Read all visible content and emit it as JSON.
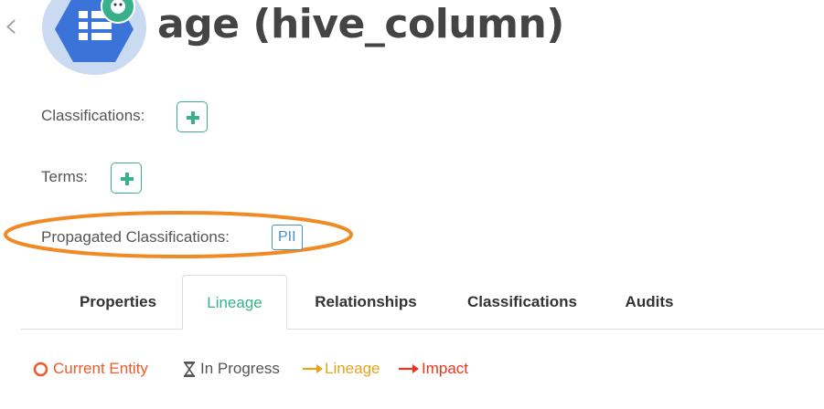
{
  "header": {
    "back_icon": "chevron-left-icon",
    "entity_icon": "table-column-icon",
    "title": "age (hive_column)"
  },
  "classifications": {
    "label": "Classifications:",
    "add_icon": "plus-icon"
  },
  "terms": {
    "label": "Terms:",
    "add_icon": "plus-icon"
  },
  "propagated_classifications": {
    "label": "Propagated Classifications:",
    "tags": [
      "PII"
    ]
  },
  "tabs": [
    {
      "label": "Properties",
      "active": false
    },
    {
      "label": "Lineage",
      "active": true
    },
    {
      "label": "Relationships",
      "active": false
    },
    {
      "label": "Classifications",
      "active": false
    },
    {
      "label": "Audits",
      "active": false
    }
  ],
  "legend": [
    {
      "label": "Current Entity",
      "icon": "circle-outline-icon",
      "color": "#f05a28"
    },
    {
      "label": "In Progress",
      "icon": "hourglass-icon",
      "color": "#555555"
    },
    {
      "label": "Lineage",
      "icon": "arrow-right-icon",
      "color": "#e8a21b"
    },
    {
      "label": "Impact",
      "icon": "arrow-right-icon",
      "color": "#f0341a"
    }
  ],
  "colors": {
    "accent": "#38b18a",
    "highlight": "#f08a24",
    "tag": "#4a90c9"
  }
}
